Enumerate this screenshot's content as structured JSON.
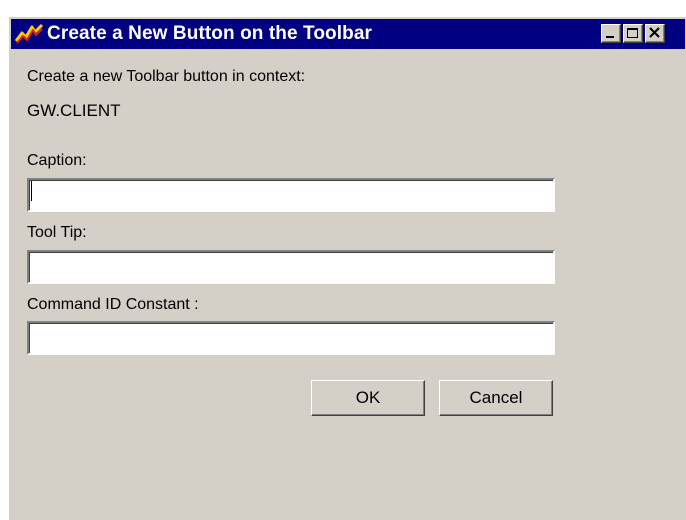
{
  "window": {
    "title": "Create a New Button on the Toolbar",
    "icon": "lightning-icon",
    "controls": [
      "minimize-icon",
      "maximize-icon",
      "close-icon"
    ]
  },
  "dialog": {
    "intro_text": "Create a new Toolbar button in context:",
    "context_value": "GW.CLIENT",
    "caption_label": "Caption:",
    "caption_value": "",
    "tooltip_label": "Tool Tip:",
    "tooltip_value": "",
    "command_label": "Command ID Constant :",
    "command_value": ""
  },
  "buttons": {
    "ok_label": "OK",
    "cancel_label": "Cancel"
  },
  "colors": {
    "titlebar": "#000080",
    "face": "#d4d0c8"
  }
}
